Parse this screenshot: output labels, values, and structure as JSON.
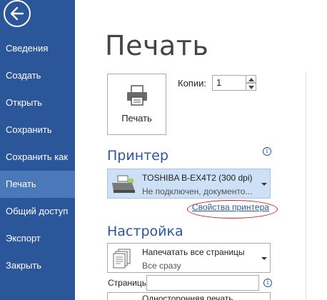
{
  "sidebar": {
    "back_icon": "arrow-left-icon",
    "items": [
      {
        "label": "Сведения"
      },
      {
        "label": "Создать"
      },
      {
        "label": "Открыть"
      },
      {
        "label": "Сохранить"
      },
      {
        "label": "Сохранить как"
      },
      {
        "label": "Печать",
        "active": true
      },
      {
        "label": "Общий доступ"
      },
      {
        "label": "Экспорт"
      },
      {
        "label": "Закрыть"
      }
    ],
    "accent_color": "#2b579a",
    "active_color": "#4a78b8"
  },
  "main": {
    "title": "Печать",
    "print_button_label": "Печать",
    "copies_label": "Копии:",
    "copies_value": "1",
    "printer_section": {
      "heading": "Принтер",
      "printer_name": "TOSHIBA B-EX4T2 (300 dpi)",
      "printer_status": "Не подключен, документо...",
      "properties_link": "Свойства принтера",
      "highlight_color": "#c8232c"
    },
    "settings_section": {
      "heading": "Настройка",
      "print_range_name": "Напечатать все страницы",
      "print_range_sub": "Все сразу",
      "pages_label": "Страницы:",
      "pages_value": "",
      "next_setting_name": "Односторонняя печать"
    }
  }
}
